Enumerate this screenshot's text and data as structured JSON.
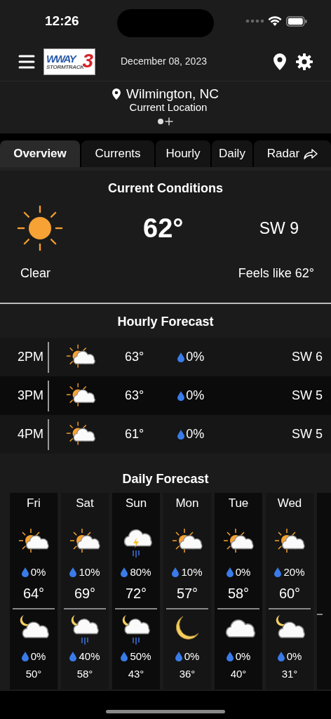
{
  "status_bar": {
    "time": "12:26"
  },
  "header": {
    "logo": {
      "wordmark": "WWAY",
      "tagline": "STORMTRACK",
      "numeral": "3"
    },
    "date": "December 08, 2023"
  },
  "location": {
    "name": "Wilmington, NC",
    "subtitle": "Current Location",
    "pages": [
      {
        "selected": true
      }
    ]
  },
  "tabs": [
    {
      "label": "Overview",
      "selected": true
    },
    {
      "label": "Currents",
      "selected": false
    },
    {
      "label": "Hourly",
      "selected": false
    },
    {
      "label": "Daily",
      "selected": false
    },
    {
      "label": "Radar",
      "selected": false,
      "external": true
    }
  ],
  "current_conditions": {
    "title": "Current Conditions",
    "kind": "sun",
    "temperature": "62°",
    "wind": "SW 9",
    "condition": "Clear",
    "feels_like": "Feels like 62°"
  },
  "hourly_forecast": {
    "title": "Hourly Forecast",
    "rows": [
      {
        "time": "2PM",
        "kind": "partly_sunny",
        "temp": "63°",
        "precip": "0%",
        "wind": "SW 6"
      },
      {
        "time": "3PM",
        "kind": "partly_sunny",
        "temp": "63°",
        "precip": "0%",
        "wind": "SW 5"
      },
      {
        "time": "4PM",
        "kind": "partly_sunny",
        "temp": "61°",
        "precip": "0%",
        "wind": "SW 5"
      }
    ]
  },
  "daily_forecast": {
    "title": "Daily Forecast",
    "days": [
      {
        "day": "Fri",
        "high": {
          "kind": "partly_sunny",
          "precip": "0%",
          "temp": "64°"
        },
        "low": {
          "kind": "partly_cloudy_night",
          "precip": "0%",
          "temp": "50°"
        }
      },
      {
        "day": "Sat",
        "high": {
          "kind": "partly_sunny",
          "precip": "10%",
          "temp": "69°"
        },
        "low": {
          "kind": "night_rain",
          "precip": "40%",
          "temp": "58°"
        }
      },
      {
        "day": "Sun",
        "high": {
          "kind": "thunderstorm",
          "precip": "80%",
          "temp": "72°"
        },
        "low": {
          "kind": "night_rain",
          "precip": "50%",
          "temp": "43°"
        }
      },
      {
        "day": "Mon",
        "high": {
          "kind": "partly_sunny",
          "precip": "10%",
          "temp": "57°"
        },
        "low": {
          "kind": "moon",
          "precip": "0%",
          "temp": "36°"
        }
      },
      {
        "day": "Tue",
        "high": {
          "kind": "partly_sunny",
          "precip": "0%",
          "temp": "58°"
        },
        "low": {
          "kind": "cloud",
          "precip": "0%",
          "temp": "40°"
        }
      },
      {
        "day": "Wed",
        "high": {
          "kind": "partly_sunny",
          "precip": "20%",
          "temp": "60°"
        },
        "low": {
          "kind": "partly_cloudy_night",
          "precip": "0%",
          "temp": "31°"
        }
      }
    ]
  }
}
